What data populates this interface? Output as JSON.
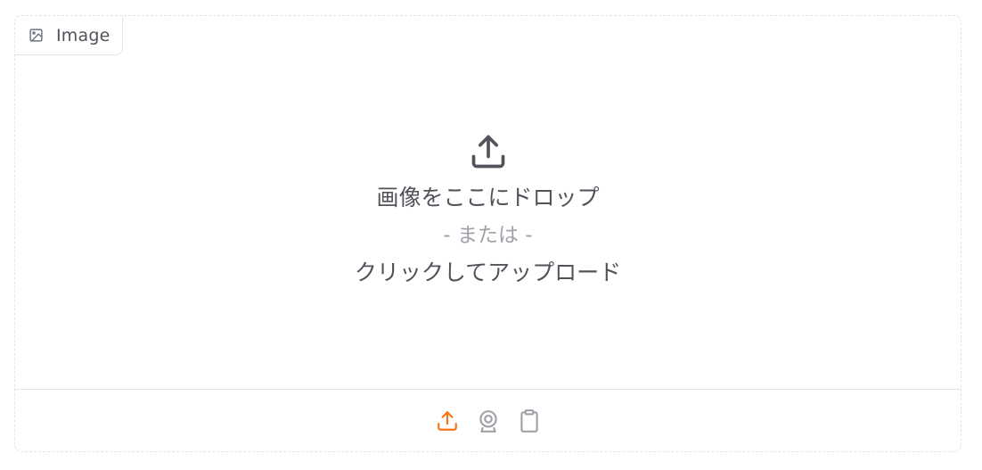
{
  "label": {
    "text": "Image",
    "icon": "image-icon"
  },
  "drop_zone": {
    "icon": "upload-icon",
    "drop_text": "画像をここにドロップ",
    "or_text": "- または -",
    "click_text": "クリックしてアップロード"
  },
  "sources": [
    {
      "name": "upload",
      "icon": "upload-icon",
      "active": true
    },
    {
      "name": "webcam",
      "icon": "webcam-icon",
      "active": false
    },
    {
      "name": "clipboard",
      "icon": "clipboard-icon",
      "active": false
    }
  ],
  "colors": {
    "accent": "#f97316",
    "muted": "#a1a1aa",
    "text": "#52525b",
    "border": "#e4e4e7"
  }
}
